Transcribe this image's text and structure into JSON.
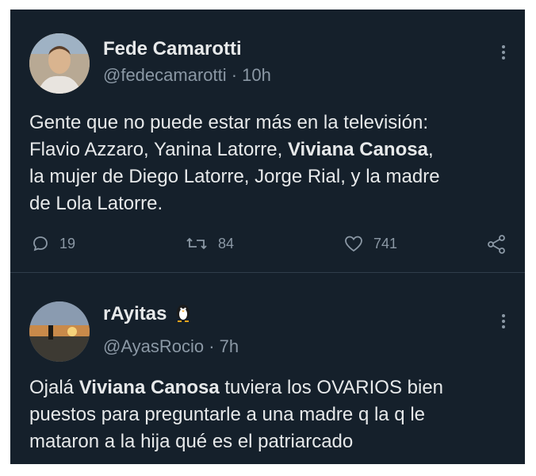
{
  "tweets": [
    {
      "name": "Fede Camarotti",
      "handle": "@fedecamarotti · 10h",
      "text_parts": {
        "a": "Gente que no puede estar más en la televisión:",
        "b": "Flavio Azzaro, Yanina Latorre, ",
        "c": "Viviana Canosa",
        "d": ",",
        "e": "la mujer de Diego Latorre, Jorge Rial, y la madre",
        "f": "de Lola Latorre."
      },
      "actions": {
        "replies": "19",
        "retweets": "84",
        "likes": "741"
      },
      "icons": {
        "reply": "reply-icon",
        "retweet": "retweet-icon",
        "like": "heart-icon",
        "share": "share-icon",
        "more": "more-options-icon"
      }
    },
    {
      "name": "rAyitas",
      "name_emoji": "penguin-icon",
      "handle": "@AyasRocio · 7h",
      "text_parts": {
        "a": "Ojalá ",
        "b": "Viviana Canosa",
        "c": " tuviera los OVARIOS bien",
        "d": "puestos para preguntarle a una madre q la q le",
        "e": "mataron a la hija qué es el patriarcado"
      }
    }
  ],
  "colors": {
    "background": "#15202b",
    "text": "#e7e9ea",
    "muted": "#8b98a5",
    "divider": "#2f3d4a"
  }
}
